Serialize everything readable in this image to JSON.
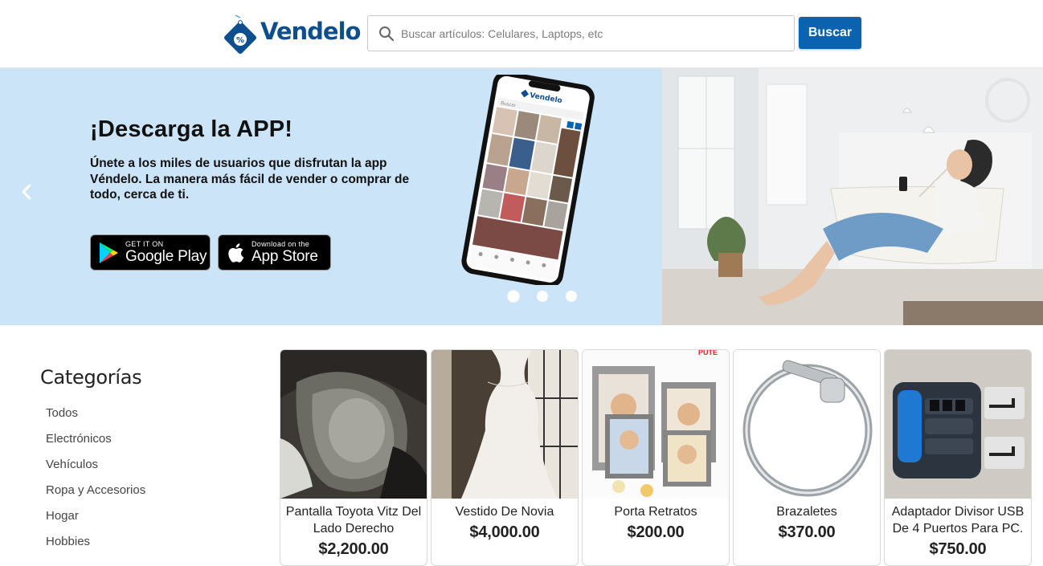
{
  "header": {
    "logo_text": "Vendelo",
    "logo_badge": "%",
    "search_placeholder": "Buscar artículos: Celulares, Laptops, etc",
    "search_button": "Buscar"
  },
  "banner": {
    "title": "¡Descarga la APP!",
    "text": "Únete a los miles de usuarios que disfrutan la app Véndelo. La manera más fácil de vender o comprar de todo, cerca de ti.",
    "google_play": {
      "small": "GET IT ON",
      "big": "Google Play"
    },
    "app_store": {
      "small": "Download on the",
      "big": "App Store"
    },
    "slides_count": 3,
    "active_slide": 1,
    "phone_app_name": "Vendelo",
    "phone_search": "Buscar"
  },
  "sidebar": {
    "title": "Categorías",
    "items": [
      "Todos",
      "Electrónicos",
      "Vehículos",
      "Ropa y Accesorios",
      "Hogar",
      "Hobbies"
    ]
  },
  "products": [
    {
      "name": "Pantalla Toyota Vitz Del Lado Derecho",
      "price": "$2,200.00"
    },
    {
      "name": "Vestido De Novia",
      "price": "$4,000.00"
    },
    {
      "name": "Porta Retratos",
      "price": "$200.00"
    },
    {
      "name": "Brazaletes",
      "price": "$370.00"
    },
    {
      "name": "Adaptador Divisor USB De 4 Puertos Para PC.",
      "price": "$750.00"
    }
  ],
  "colors": {
    "brand": "#0d4e8e",
    "button": "#0b63b0",
    "banner_bg": "#cce4f8"
  }
}
